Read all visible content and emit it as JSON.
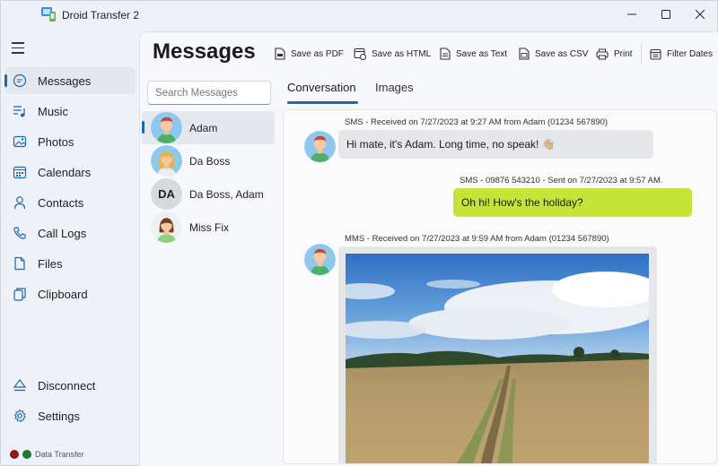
{
  "app": {
    "title": "Droid Transfer 2"
  },
  "window_controls": {
    "minimize": "—",
    "maximize": "☐",
    "close": "✕"
  },
  "sidebar": {
    "items": [
      {
        "label": "Messages",
        "icon": "message-icon",
        "active": true
      },
      {
        "label": "Music",
        "icon": "music-icon"
      },
      {
        "label": "Photos",
        "icon": "photo-icon"
      },
      {
        "label": "Calendars",
        "icon": "calendar-icon"
      },
      {
        "label": "Contacts",
        "icon": "contact-icon"
      },
      {
        "label": "Call Logs",
        "icon": "phone-icon"
      },
      {
        "label": "Files",
        "icon": "file-icon"
      },
      {
        "label": "Clipboard",
        "icon": "clipboard-icon"
      }
    ],
    "bottom": [
      {
        "label": "Disconnect",
        "icon": "eject-icon"
      },
      {
        "label": "Settings",
        "icon": "gear-icon"
      }
    ],
    "status": {
      "label": "Data Transfer",
      "colors": [
        "#8b1a1a",
        "#1a7a2e"
      ]
    }
  },
  "page": {
    "title": "Messages"
  },
  "toolbar": {
    "save_pdf": "Save as PDF",
    "save_html": "Save as HTML",
    "save_text": "Save as Text",
    "save_csv": "Save as CSV",
    "print": "Print",
    "filter_dates": "Filter Dates"
  },
  "search": {
    "placeholder": "Search Messages"
  },
  "contacts": [
    {
      "name": "Adam",
      "avatar": "male-avatar",
      "active": true
    },
    {
      "name": "Da Boss",
      "avatar": "female-avatar"
    },
    {
      "name": "Da Boss, Adam",
      "avatar": "initials",
      "initials": "DA"
    },
    {
      "name": "Miss Fix",
      "avatar": "female-dark-avatar"
    }
  ],
  "tabs": [
    {
      "label": "Conversation",
      "active": true
    },
    {
      "label": "Images"
    }
  ],
  "messages": [
    {
      "meta": "SMS - Received on 7/27/2023 at 9:27 AM from Adam (01234 567890)",
      "text": "Hi mate, it's Adam. Long time, no speak! 👋🏼",
      "direction": "in"
    },
    {
      "meta": "SMS - 09876 543210 - Sent on 7/27/2023 at 9:57 AM.",
      "text": "Oh hi! How's the holiday?",
      "direction": "out"
    },
    {
      "meta": "MMS - Received on 7/27/2023 at 9:59 AM from Adam (01234 567890)",
      "attachment": "landscape-photo",
      "direction": "in"
    }
  ],
  "colors": {
    "accent": "#1f6aa5",
    "sent_bubble": "#c4e538",
    "received_bubble": "#e6e7ea"
  }
}
